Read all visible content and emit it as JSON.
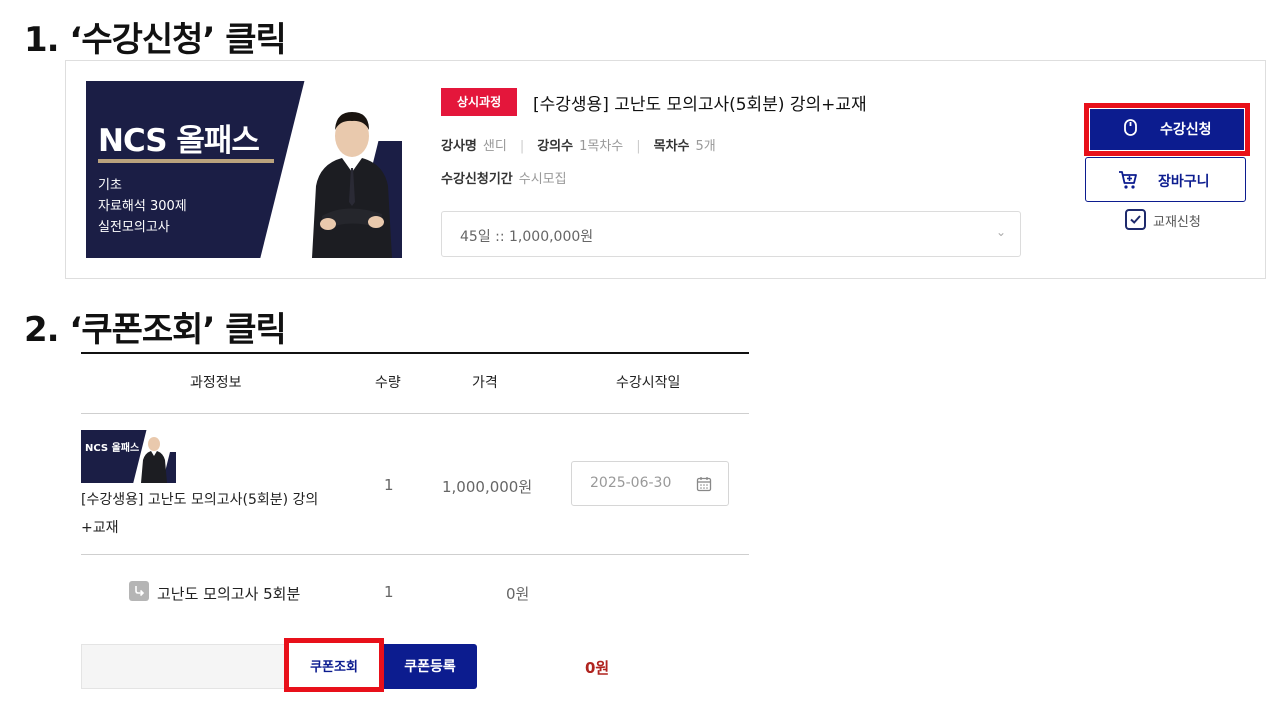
{
  "steps": {
    "step1": "1. ‘수강신청’ 클릭",
    "step2": "2. ‘쿠폰조회’ 클릭"
  },
  "product": {
    "thumbnail": {
      "title": "NCS 올패스",
      "lines": [
        "기초",
        "자료해석 300제",
        "실전모의고사"
      ]
    },
    "tag": "상시과정",
    "title": "[수강생용] 고난도 모의고사(5회분) 강의+교재",
    "meta": {
      "instructor_label": "강사명",
      "instructor_value": "샌디",
      "lectures_label": "강의수",
      "lectures_value": "1목차수",
      "chapters_label": "목차수",
      "chapters_value": "5개"
    },
    "period_label": "수강신청기간",
    "period_value": "수시모집",
    "option_selected": "45일  :: 1,000,000원",
    "enroll_label": "수강신청",
    "cart_label": "장바구니",
    "book_label": "교재신청",
    "book_checked": true
  },
  "table": {
    "headers": [
      "과정정보",
      "수량",
      "가격",
      "수강시작일"
    ],
    "rows": [
      {
        "thumb_title": "NCS 올패스",
        "name": "[수강생용] 고난도 모의고사(5회분) 강의+교재",
        "qty": "1",
        "price": "1,000,000원",
        "start_date": "2025-06-30"
      },
      {
        "name": "고난도 모의고사 5회분",
        "qty": "1",
        "price": "0원"
      }
    ]
  },
  "coupon": {
    "input_value": "",
    "check_label": "쿠폰조회",
    "register_label": "쿠폰등록",
    "discount": "0원"
  },
  "colors": {
    "primary": "#0c1c8f",
    "highlight": "#e8101a",
    "tag": "#e4163b",
    "thumb_bg": "#1b1e45",
    "discount": "#b0241f"
  }
}
